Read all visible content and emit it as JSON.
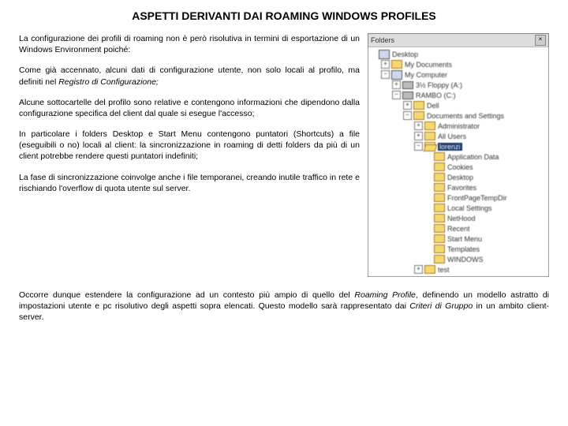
{
  "title": "ASPETTI DERIVANTI DAI ROAMING WINDOWS PROFILES",
  "paragraphs": {
    "p1": "La configurazione dei profili di roaming non è però risolutiva in termini di esportazione di un Windows Environment poiché:",
    "p2a": "Come già accennato, alcuni dati di configurazione utente, non solo locali al profilo, ma definiti nel ",
    "p2b_italic": "Registro di Configurazione;",
    "p3": "Alcune sottocartelle del profilo sono relative e contengono informazioni che dipendono dalla configurazione specifica del client dal quale si esegue l'accesso;",
    "p4": "In particolare i folders Desktop e Start Menu contengono puntatori (Shortcuts) a file (eseguibili o no) locali al client: la sincronizzazione in roaming di detti folders da più di un client potrebbe rendere questi puntatori indefiniti;",
    "p5": "La fase di sincronizzazione coinvolge anche i file temporanei, creando inutile traffico in rete e rischiando l'overflow di quota utente sul server.",
    "footer_a": "Occorre dunque estendere la configurazione ad un contesto più ampio di quello del ",
    "footer_b_italic": "Roaming Profile",
    "footer_c": ", definendo un modello astratto di impostazioni utente e pc risolutivo degli aspetti sopra elencati. Questo modello sarà rappresentato dai ",
    "footer_d_italic": "Criteri di Gruppo",
    "footer_e": " in un ambito client-server."
  },
  "tree": {
    "header": "Folders",
    "close": "×",
    "items": [
      {
        "indent": 0,
        "glyph": "",
        "icon": "comp",
        "label": "Desktop"
      },
      {
        "indent": 1,
        "glyph": "+",
        "icon": "folder",
        "label": "My Documents"
      },
      {
        "indent": 1,
        "glyph": "−",
        "icon": "comp",
        "label": "My Computer"
      },
      {
        "indent": 2,
        "glyph": "+",
        "icon": "disk",
        "label": "3½ Floppy (A:)"
      },
      {
        "indent": 2,
        "glyph": "−",
        "icon": "disk",
        "label": "RAMBO (C:)"
      },
      {
        "indent": 3,
        "glyph": "+",
        "icon": "folder",
        "label": "Dell"
      },
      {
        "indent": 3,
        "glyph": "−",
        "icon": "folder",
        "label": "Documents and Settings"
      },
      {
        "indent": 4,
        "glyph": "+",
        "icon": "folder",
        "label": "Administrator"
      },
      {
        "indent": 4,
        "glyph": "+",
        "icon": "folder",
        "label": "All Users"
      },
      {
        "indent": 4,
        "glyph": "−",
        "icon": "folder-open",
        "label": "lorenzi",
        "selected": true
      },
      {
        "indent": 5,
        "glyph": "",
        "icon": "folder",
        "label": "Application Data"
      },
      {
        "indent": 5,
        "glyph": "",
        "icon": "folder",
        "label": "Cookies"
      },
      {
        "indent": 5,
        "glyph": "",
        "icon": "folder",
        "label": "Desktop"
      },
      {
        "indent": 5,
        "glyph": "",
        "icon": "folder",
        "label": "Favorites"
      },
      {
        "indent": 5,
        "glyph": "",
        "icon": "folder",
        "label": "FrontPageTempDir"
      },
      {
        "indent": 5,
        "glyph": "",
        "icon": "folder",
        "label": "Local Settings"
      },
      {
        "indent": 5,
        "glyph": "",
        "icon": "folder",
        "label": "NetHood"
      },
      {
        "indent": 5,
        "glyph": "",
        "icon": "folder",
        "label": "Recent"
      },
      {
        "indent": 5,
        "glyph": "",
        "icon": "folder",
        "label": "Start Menu"
      },
      {
        "indent": 5,
        "glyph": "",
        "icon": "folder",
        "label": "Templates"
      },
      {
        "indent": 5,
        "glyph": "",
        "icon": "folder",
        "label": "WINDOWS"
      },
      {
        "indent": 4,
        "glyph": "+",
        "icon": "folder",
        "label": "test"
      }
    ]
  }
}
